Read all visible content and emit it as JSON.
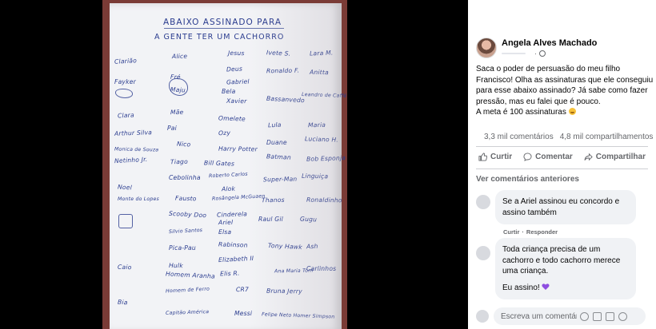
{
  "post": {
    "author_name": "Angela Alves Machado",
    "text": "Saca o poder de persuasão do meu filho Francisco! Olha as assinaturas que ele conseguiu para esse abaixo assinado? Já sabe como fazer pressão, mas eu falei que é pouco.\nA meta é 100 assinaturas",
    "comment_count": "3,3 mil comentários",
    "share_count": "4,8 mil compartilhamentos"
  },
  "actions": {
    "like": "Curtir",
    "comment": "Comentar",
    "share": "Compartilhar"
  },
  "comments": {
    "view_previous": "Ver comentários anteriores",
    "items": [
      {
        "text": "Se a Ariel assinou eu concordo e assino também",
        "like": "Curtir",
        "reply": "Responder",
        "separator": "·"
      },
      {
        "text": "Toda criança precisa de um cachorro e todo cachorro merece uma criança.",
        "text2": "Eu assino!"
      }
    ],
    "compose_placeholder": "Escreva um comentár..."
  },
  "petition": {
    "title1": "ABAIXO ASSINADO PARA",
    "title2": "A GENTE TER UM CACHORRO",
    "signatures": [
      "Clarião",
      "Alice",
      "Jesus",
      "Ivete S.",
      "Lara M.",
      "Fayker",
      "Fré",
      "Deus",
      "Ronaldo F.",
      "Anitta",
      "Maju",
      "Gabriel",
      "Bela",
      "Leandro de Caffé",
      "Clara",
      "Mãe",
      "Xavier",
      "Bassanvedo",
      "Arthur Silva",
      "Pai",
      "Omelete",
      "Lula",
      "Maria",
      "Monica de Souza",
      "Nico",
      "Ozy",
      "Duane",
      "Luciano H.",
      "Netinho Jr.",
      "Tiago",
      "Harry Potter",
      "Batman",
      "Bob Esponja",
      "Cebolinha",
      "Bill Gates",
      "Roberto Carlos",
      "Super-Man",
      "Linguiça",
      "Noel",
      "Alok",
      "Monte do Lopes",
      "Fausto",
      "Rosângela McGuaen",
      "Thanos",
      "Ronaldinho",
      "Scooby Doo",
      "Cinderela",
      "Raul Gil",
      "Gugu",
      "Silvio Santos",
      "Ariel",
      "Elsa",
      "Tony Hawk",
      "Ash",
      "Pica-Pau",
      "Rabinson",
      "Elizabeth II",
      "Ana Maria Tom",
      "Hulk",
      "Homem Aranha",
      "Elis R.",
      "Carlinhos",
      "Caio",
      "Homem de Ferro",
      "CR7",
      "Bruna Jerry",
      "Bia",
      "Capitão América",
      "Messi",
      "Felipe Neto Homer Simpson"
    ]
  },
  "colors": {
    "accent": "#65676b",
    "ink": "#2a3c8f",
    "bubble": "#f0f2f5",
    "heart": "#8e4ee0"
  }
}
